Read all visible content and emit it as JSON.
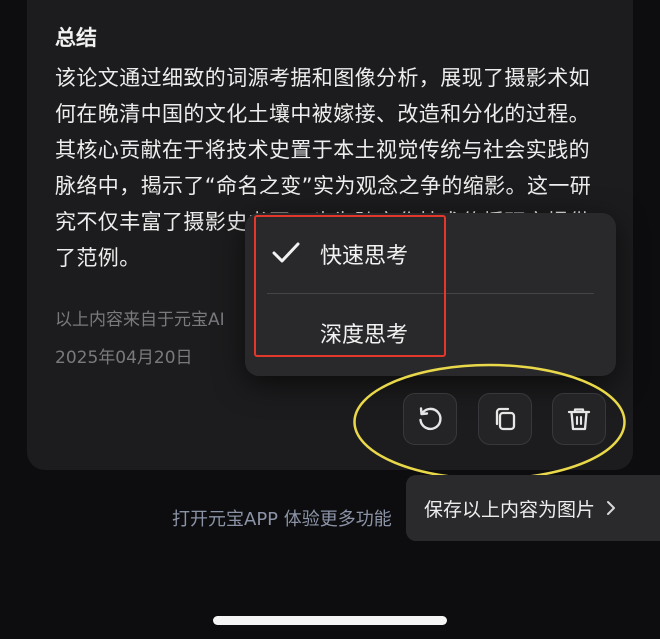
{
  "summary": {
    "title": "总结",
    "body": "该论文通过细致的词源考据和图像分析，展现了摄影术如何在晚清中国的文化土壤中被嫁接、改造和分化的过程。其核心贡献在于将技术史置于本土视觉传统与社会实践的脉络中，揭示了“命名之变”实为观念之争的缩影。这一研究不仅丰富了摄影史书写，也为跨文化技术传播研究提供了范例。",
    "source_note": "以上内容来自于元宝AI",
    "date": "2025年04月20日"
  },
  "menu": {
    "items": [
      {
        "label": "快速思考",
        "selected": true
      },
      {
        "label": "深度思考",
        "selected": false
      }
    ]
  },
  "actions": {
    "icons": [
      "refresh-icon",
      "copy-icon",
      "trash-icon"
    ]
  },
  "promo": {
    "text": "打开元宝APP 体验更多功能"
  },
  "save_tip": {
    "label": "保存以上内容为图片"
  },
  "colors": {
    "background": "#0d0d0f",
    "card": "#1c1c1e",
    "menu": "#29292c",
    "highlight_box": "#e2372b",
    "annotation_ellipse": "#e9d84a",
    "promo_text": "#8b93a6"
  }
}
